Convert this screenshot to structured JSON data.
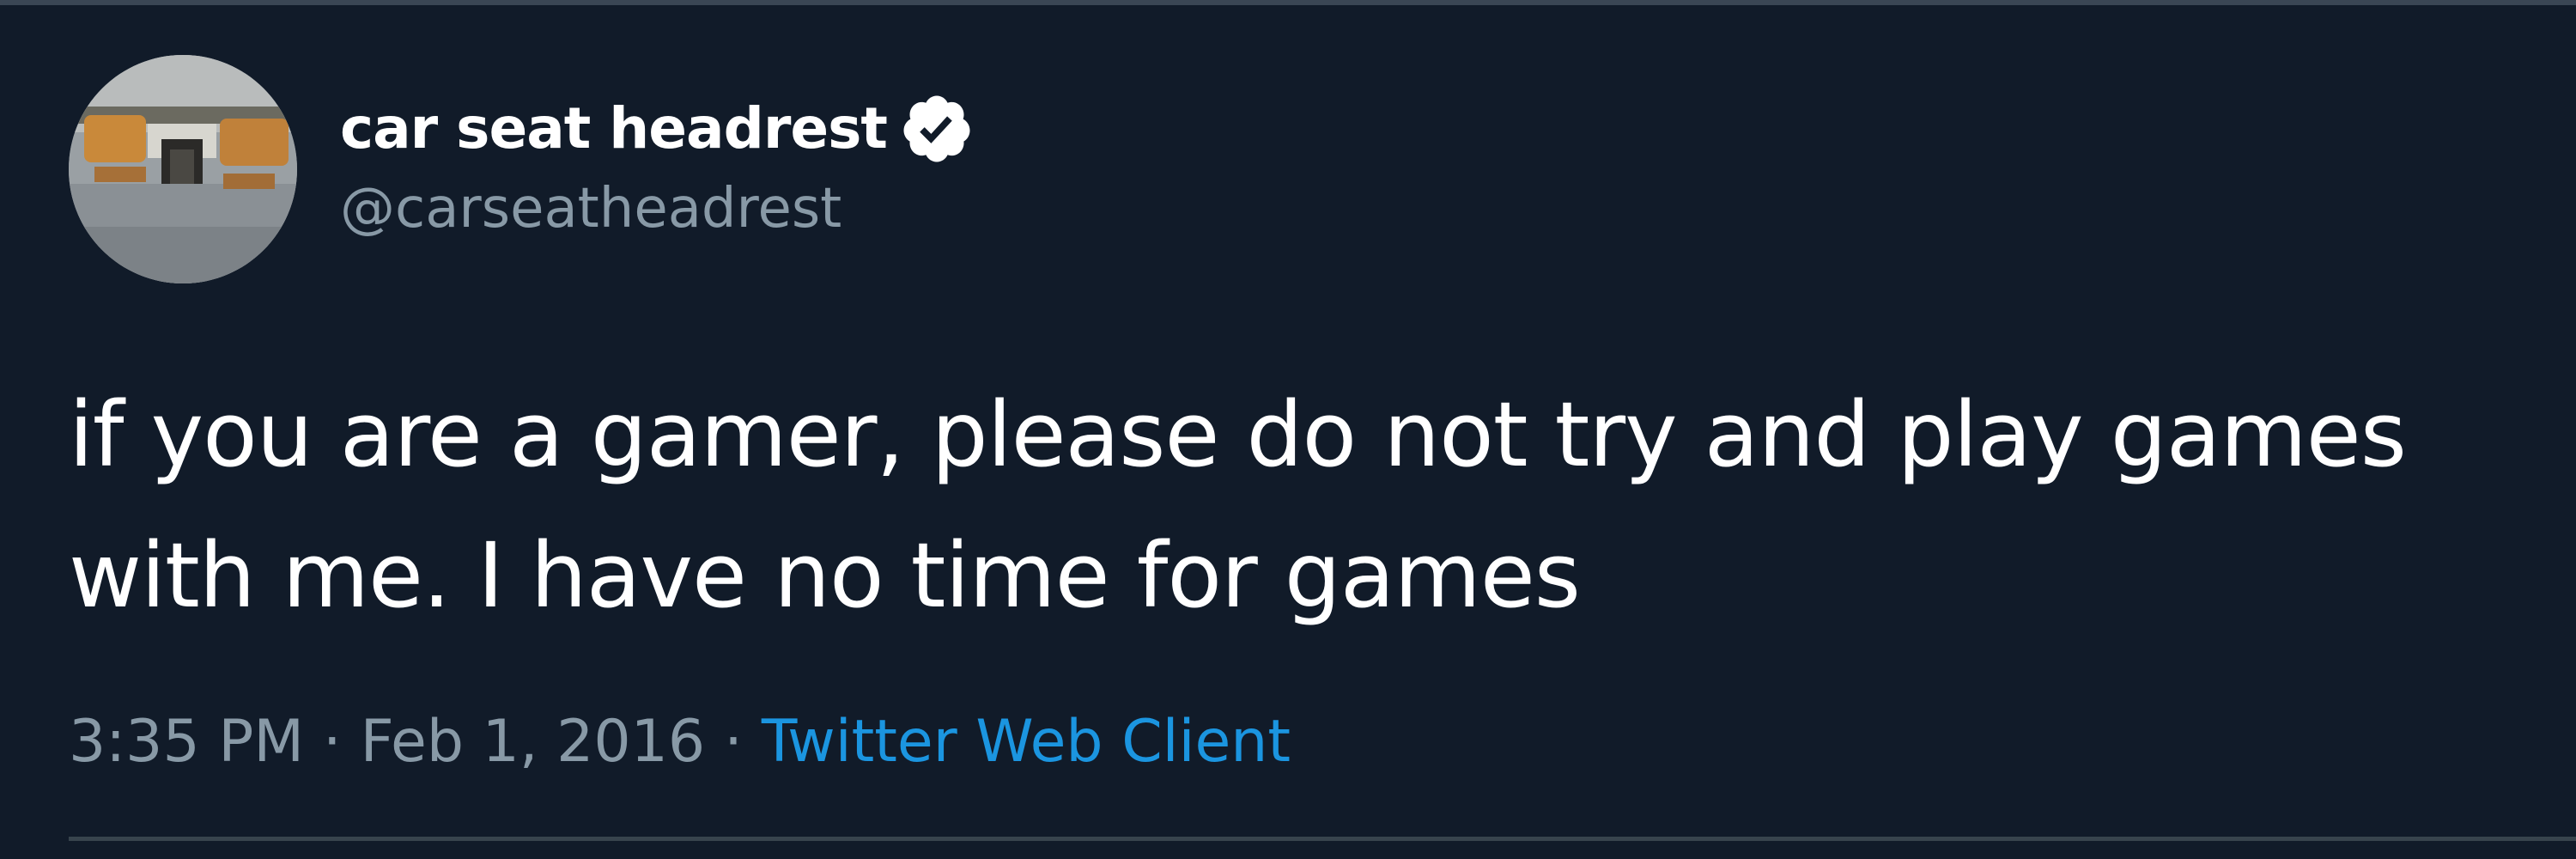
{
  "tweet": {
    "author": {
      "display_name": "car seat headrest",
      "handle": "@carseatheadrest",
      "verified": true
    },
    "text": "if you are a gamer, please do not try and play games with me. I have no time for games",
    "time": "3:35 PM",
    "separator": "·",
    "date": "Feb 1, 2016",
    "source": "Twitter Web Client"
  },
  "icons": {
    "avatar": "profile-photo",
    "verified": "verified-badge-icon"
  },
  "colors": {
    "background": "#111b29",
    "text": "#ffffff",
    "secondary": "#8899a6",
    "link": "#1b95e0",
    "divider": "#38444d"
  }
}
